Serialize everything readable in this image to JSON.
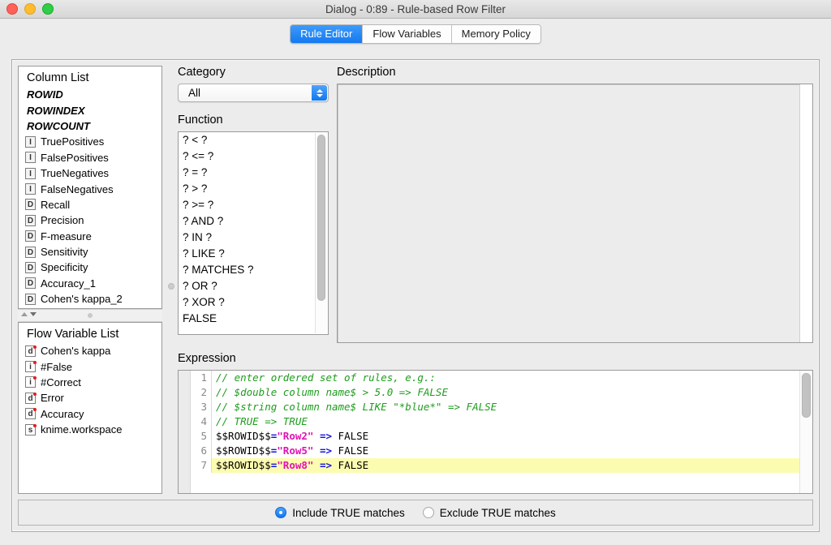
{
  "window": {
    "title": "Dialog - 0:89 - Rule-based Row Filter",
    "traffic_lights": [
      "close-button",
      "minimize-button",
      "zoom-button"
    ]
  },
  "tabs": [
    {
      "label": "Rule Editor",
      "active": true
    },
    {
      "label": "Flow Variables",
      "active": false
    },
    {
      "label": "Memory Policy",
      "active": false
    }
  ],
  "column_list": {
    "title": "Column List",
    "plain_items": [
      "ROWID",
      "ROWINDEX",
      "ROWCOUNT"
    ],
    "items": [
      {
        "type": "I",
        "label": "TruePositives"
      },
      {
        "type": "I",
        "label": "FalsePositives"
      },
      {
        "type": "I",
        "label": "TrueNegatives"
      },
      {
        "type": "I",
        "label": "FalseNegatives"
      },
      {
        "type": "D",
        "label": "Recall"
      },
      {
        "type": "D",
        "label": "Precision"
      },
      {
        "type": "D",
        "label": "F-measure"
      },
      {
        "type": "D",
        "label": "Sensitivity"
      },
      {
        "type": "D",
        "label": "Specificity"
      },
      {
        "type": "D",
        "label": "Accuracy_1"
      },
      {
        "type": "D",
        "label": "Cohen's kappa_2"
      }
    ]
  },
  "flow_variable_list": {
    "title": "Flow Variable List",
    "items": [
      {
        "type": "d",
        "label": "Cohen's kappa"
      },
      {
        "type": "i",
        "label": "#False"
      },
      {
        "type": "i",
        "label": "#Correct"
      },
      {
        "type": "d",
        "label": "Error"
      },
      {
        "type": "d",
        "label": "Accuracy"
      },
      {
        "type": "s",
        "label": "knime.workspace"
      }
    ]
  },
  "category": {
    "label": "Category",
    "selected": "All"
  },
  "function": {
    "label": "Function",
    "items": [
      "? < ?",
      "? <= ?",
      "? = ?",
      "? > ?",
      "? >= ?",
      "? AND ?",
      "? IN ?",
      "? LIKE ?",
      "? MATCHES ?",
      "? OR ?",
      "? XOR ?",
      "FALSE"
    ]
  },
  "description": {
    "label": "Description",
    "body": ""
  },
  "expression": {
    "label": "Expression",
    "lines": [
      {
        "number": "1",
        "highlighted": false,
        "tokens": [
          {
            "text": "// enter ordered set of rules, e.g.:",
            "style": "comment"
          }
        ]
      },
      {
        "number": "2",
        "highlighted": false,
        "tokens": [
          {
            "text": "// $double column name$ > 5.0 => FALSE",
            "style": "comment"
          }
        ]
      },
      {
        "number": "3",
        "highlighted": false,
        "tokens": [
          {
            "text": "// $string column name$ LIKE \"*blue*\" => FALSE",
            "style": "comment"
          }
        ]
      },
      {
        "number": "4",
        "highlighted": false,
        "tokens": [
          {
            "text": "// TRUE => TRUE",
            "style": "comment"
          }
        ]
      },
      {
        "number": "5",
        "highlighted": false,
        "tokens": [
          {
            "text": "$$ROWID$$",
            "style": "plain"
          },
          {
            "text": "=",
            "style": "op"
          },
          {
            "text": "\"Row2\"",
            "style": "str"
          },
          {
            "text": " ",
            "style": "plain"
          },
          {
            "text": "=>",
            "style": "op"
          },
          {
            "text": " FALSE",
            "style": "plain"
          }
        ]
      },
      {
        "number": "6",
        "highlighted": false,
        "tokens": [
          {
            "text": "$$ROWID$$",
            "style": "plain"
          },
          {
            "text": "=",
            "style": "op"
          },
          {
            "text": "\"Row5\"",
            "style": "str"
          },
          {
            "text": " ",
            "style": "plain"
          },
          {
            "text": "=>",
            "style": "op"
          },
          {
            "text": " FALSE",
            "style": "plain"
          }
        ]
      },
      {
        "number": "7",
        "highlighted": true,
        "tokens": [
          {
            "text": "$$ROWID$$",
            "style": "plain"
          },
          {
            "text": "=",
            "style": "op"
          },
          {
            "text": "\"Row8\"",
            "style": "str"
          },
          {
            "text": " ",
            "style": "plain"
          },
          {
            "text": "=>",
            "style": "op"
          },
          {
            "text": " FALSE",
            "style": "plain"
          }
        ]
      }
    ]
  },
  "match_options": [
    {
      "label": "Include TRUE matches",
      "selected": true
    },
    {
      "label": "Exclude TRUE matches",
      "selected": false
    }
  ],
  "colors": {
    "accent": "#1479f0",
    "comment": "#1d9d1d",
    "string": "#e011b5",
    "operator": "#1414dd",
    "highlight_row": "#fcfcb0",
    "flow_var_dot": "#e81c1c"
  }
}
